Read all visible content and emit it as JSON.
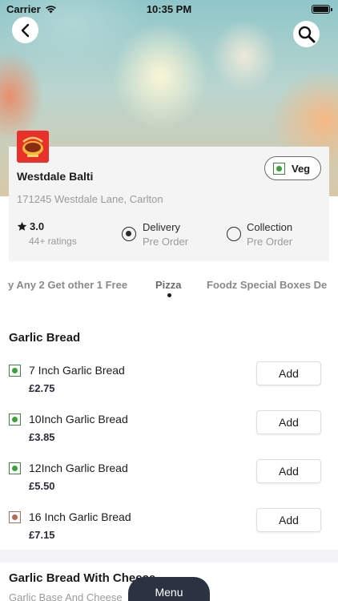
{
  "status_bar": {
    "carrier": "Carrier",
    "time": "10:35 PM"
  },
  "restaurant": {
    "name": "Westdale Balti",
    "address": "171245 Westdale Lane, Carlton",
    "veg_label": "Veg",
    "rating": "3.0",
    "ratings_count": "44+ ratings",
    "options": [
      {
        "label": "Delivery",
        "sub": "Pre Order",
        "selected": true
      },
      {
        "label": "Collection",
        "sub": "Pre Order",
        "selected": false
      }
    ]
  },
  "category_tabs": [
    {
      "label": "y Any 2 Get other 1 Free",
      "active": false
    },
    {
      "label": "Pizza",
      "active": true
    },
    {
      "label": "Foodz Special Boxes De",
      "active": false
    }
  ],
  "sections": [
    {
      "title": "Garlic Bread",
      "items": [
        {
          "name": "7 Inch Garlic Bread",
          "price": "£2.75",
          "type": "veg",
          "add_label": "Add"
        },
        {
          "name": "10Inch Garlic Bread",
          "price": "£3.85",
          "type": "veg",
          "add_label": "Add"
        },
        {
          "name": "12Inch Garlic Bread",
          "price": "£5.50",
          "type": "veg",
          "add_label": "Add"
        },
        {
          "name": "16 Inch Garlic Bread",
          "price": "£7.15",
          "type": "nonveg",
          "add_label": "Add"
        }
      ]
    },
    {
      "title": "Garlic Bread With Cheese",
      "subtitle": "Garlic Base And Cheese"
    }
  ],
  "menu_button_label": "Menu",
  "colors": {
    "veg": "#3aa13a",
    "nonveg": "#b26b55",
    "menu_button": "#2b3242",
    "logo": "#e9302b"
  }
}
